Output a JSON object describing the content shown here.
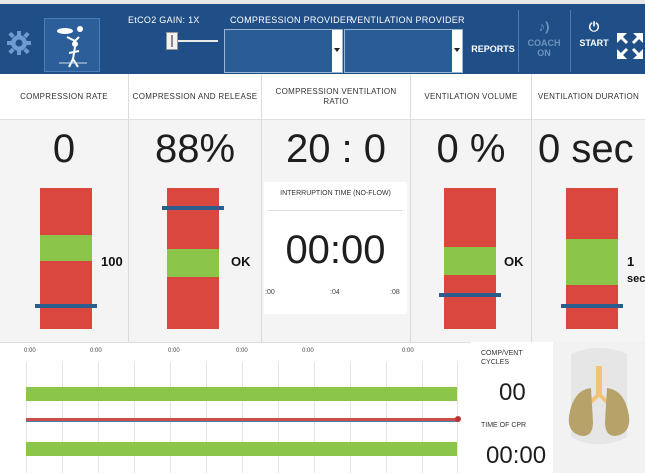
{
  "toolbar": {
    "gain_label": "EtCO2 GAIN: 1X",
    "compression_provider_label": "COMPRESSION PROVIDER",
    "compression_provider_value": "",
    "ventilation_provider_label": "VENTILATION PROVIDER",
    "ventilation_provider_value": "",
    "reports_label": "REPORTS",
    "coach_label": "COACH ON",
    "start_label": "START",
    "icons": {
      "settings": "gear-icon",
      "cpr": "cpr-figure-icon",
      "coach": "speaker-icon",
      "start": "power-icon",
      "fullscreen": "expand-icon"
    }
  },
  "metrics": {
    "compression_rate": {
      "title": "COMPRESSION RATE",
      "value": "0",
      "target_label": "100",
      "green_band": [
        0.48,
        0.67
      ],
      "marker": 0.16
    },
    "compression_release": {
      "title": "COMPRESSION AND RELEASE",
      "value": "88%",
      "target_label": "OK",
      "green_band": [
        0.37,
        0.57
      ],
      "marker": 0.86
    },
    "ratio": {
      "title": "COMPRESSION VENTILATION RATIO",
      "value": "20 : 0"
    },
    "ventilation_volume": {
      "title": "VENTILATION VOLUME",
      "value": "0 %",
      "target_label": "OK",
      "green_band": [
        0.38,
        0.58
      ],
      "marker": 0.24
    },
    "ventilation_duration": {
      "title": "VENTILATION DURATION",
      "value": "0 sec",
      "target_label_1": "1",
      "target_label_2": "sec",
      "green_band": [
        0.31,
        0.64
      ],
      "marker": 0.16
    }
  },
  "interruption": {
    "title": "INTERRUPTION TIME (NO-FLOW)",
    "value": "00:00",
    "ticks": [
      ":00",
      ":04",
      ":08"
    ]
  },
  "timeline": {
    "times": [
      "0:00",
      "0:00",
      "0:00",
      "0:00",
      "0:00",
      "0:00"
    ],
    "cycles_label_1": "COMP/VENT",
    "cycles_label_2": "CYCLES",
    "cycles_value": "00",
    "cpr_time_label": "TIME OF CPR",
    "cpr_time_value": "00:00"
  },
  "colors": {
    "toolbar": "#1f4f86",
    "red_zone": "#d9473f",
    "green_zone": "#8bc64a",
    "marker": "#2b5e8c"
  }
}
